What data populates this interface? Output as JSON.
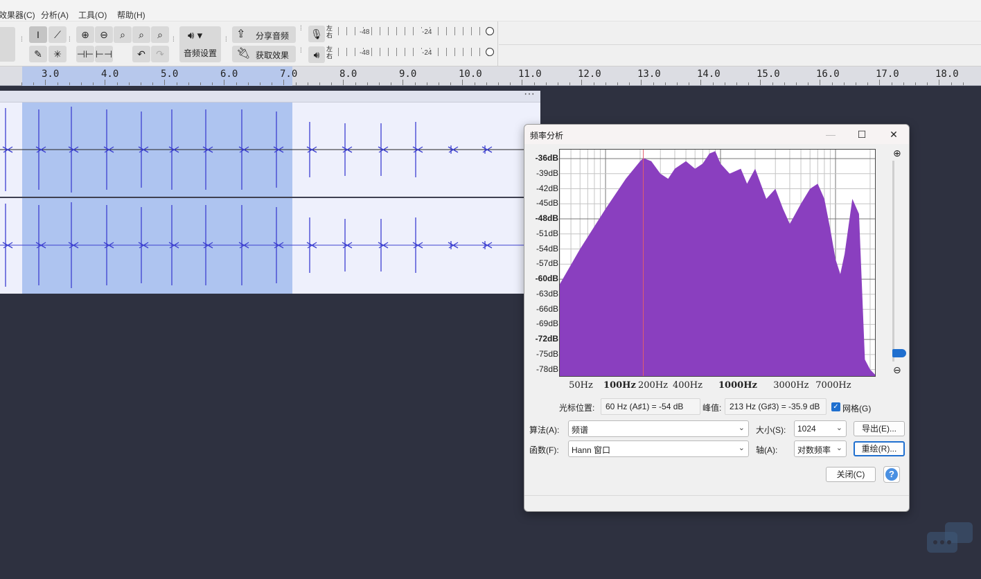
{
  "menubar": {
    "items": [
      "效果器(C)",
      "分析(A)",
      "工具(O)",
      "帮助(H)"
    ]
  },
  "toolbar": {
    "audio_setup_label": "音频设置",
    "share_audio_label": "分享音频",
    "get_effects_label": "获取效果",
    "record_meter": {
      "mark_48": "-48",
      "mark_24": "-24",
      "lr_label": "左右"
    },
    "play_meter": {
      "mark_48": "-48",
      "mark_24": "-24",
      "lr_label": "左右"
    }
  },
  "ruler": {
    "ticks": [
      "3.0",
      "4.0",
      "5.0",
      "6.0",
      "7.0",
      "8.0",
      "9.0",
      "10.0",
      "11.0",
      "12.0",
      "13.0",
      "14.0",
      "15.0",
      "16.0",
      "17.0",
      "18.0"
    ],
    "selection_start": 2.7,
    "selection_end": 7.0
  },
  "track": {
    "menu_glyph": "···"
  },
  "dialog": {
    "title": "频率分析",
    "y_labels": [
      "-36dB",
      "-39dB",
      "-42dB",
      "-45dB",
      "-48dB",
      "-51dB",
      "-54dB",
      "-57dB",
      "-60dB",
      "-63dB",
      "-66dB",
      "-69dB",
      "-72dB",
      "-75dB",
      "-78dB"
    ],
    "x_labels": [
      "50Hz",
      "100Hz",
      "200Hz",
      "400Hz",
      "1000Hz",
      "3000Hz",
      "7000Hz"
    ],
    "cursor_label": "光标位置:",
    "cursor_value": "60 Hz (A♯1) = -54 dB",
    "peak_label": "峰值:",
    "peak_value": "213 Hz (G♯3) = -35.9 dB",
    "grid_label": "网格(G)",
    "grid_checked": true,
    "algorithm_label": "算法(A):",
    "algorithm_value": "频谱",
    "size_label": "大小(S):",
    "size_value": "1024",
    "export_label": "导出(E)...",
    "function_label": "函数(F):",
    "function_value": "Hann 窗口",
    "axis_label": "轴(A):",
    "axis_value": "对数频率",
    "replot_label": "重绘(R)...",
    "close_label": "关闭(C)",
    "help_glyph": "?"
  },
  "chart_data": {
    "type": "area",
    "title": "",
    "xlabel": "",
    "ylabel": "",
    "xscale": "log",
    "xlim": [
      40,
      22050
    ],
    "ylim": [
      -79,
      -34
    ],
    "grid": true,
    "x": [
      40,
      60,
      100,
      150,
      200,
      213,
      250,
      300,
      350,
      400,
      500,
      600,
      700,
      800,
      900,
      1000,
      1200,
      1500,
      1700,
      2000,
      2500,
      3000,
      3500,
      4000,
      5000,
      6000,
      7000,
      8000,
      9000,
      10000,
      11000,
      12000,
      14000,
      16000,
      18000,
      20000,
      22050
    ],
    "values": [
      -61,
      -54,
      -46,
      -40,
      -36.5,
      -35.9,
      -36.5,
      -39,
      -40,
      -38,
      -36.5,
      -38,
      -37,
      -35,
      -34.5,
      -37,
      -39,
      -38,
      -41,
      -38,
      -44,
      -42,
      -46,
      -49,
      -45,
      -42,
      -41,
      -44,
      -50,
      -56,
      -59,
      -55,
      -44,
      -47,
      -76,
      -78,
      -79
    ]
  },
  "colors": {
    "spectrum_fill": "#8a3fbf",
    "waveform": "#3c3fd0",
    "selection": "#aec4f0",
    "accent": "#1f6fcf"
  }
}
